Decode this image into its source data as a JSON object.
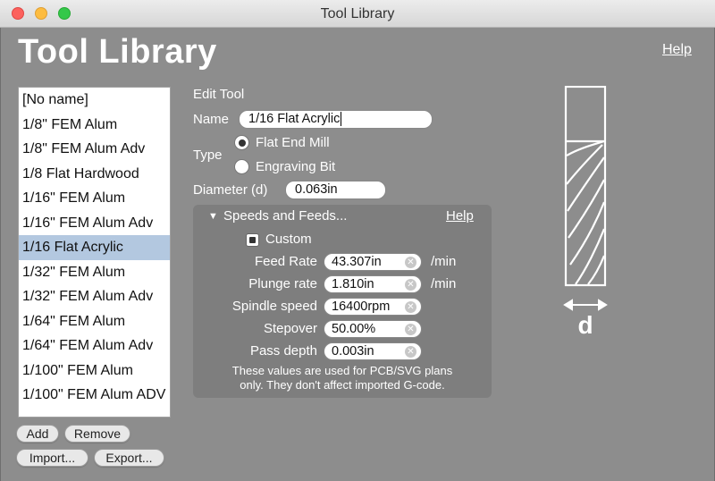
{
  "window": {
    "title": "Tool Library"
  },
  "header": {
    "title": "Tool Library",
    "help": "Help"
  },
  "tools": [
    "[No name]",
    "1/8\" FEM Alum",
    "1/8\" FEM Alum Adv",
    "1/8 Flat Hardwood",
    "1/16\" FEM Alum",
    "1/16\" FEM Alum Adv",
    "1/16 Flat Acrylic",
    "1/32\" FEM Alum",
    "1/32\" FEM Alum Adv",
    "1/64\" FEM Alum",
    "1/64\" FEM Alum Adv",
    "1/100\" FEM Alum",
    "1/100\" FEM Alum ADV"
  ],
  "selected_index": 6,
  "list_buttons": {
    "add": "Add",
    "remove": "Remove",
    "import": "Import...",
    "export": "Export..."
  },
  "edit": {
    "heading": "Edit Tool",
    "name_label": "Name",
    "name_value": "1/16 Flat Acrylic",
    "type_label": "Type",
    "type_flat": "Flat End Mill",
    "type_engraving": "Engraving Bit",
    "diameter_label": "Diameter (d)",
    "diameter_value": "0.063in"
  },
  "speeds": {
    "heading": "Speeds and Feeds...",
    "help": "Help",
    "custom_label": "Custom",
    "feed_label": "Feed Rate",
    "feed_value": "43.307in",
    "feed_unit": "/min",
    "plunge_label": "Plunge rate",
    "plunge_value": "1.810in",
    "plunge_unit": "/min",
    "spindle_label": "Spindle speed",
    "spindle_value": "16400rpm",
    "stepover_label": "Stepover",
    "stepover_value": "50.00%",
    "pass_label": "Pass depth",
    "pass_value": "0.003in",
    "note_line1": "These values are used for PCB/SVG plans",
    "note_line2": "only. They don't affect imported G-code."
  },
  "diagram": {
    "label": "d"
  },
  "colors": {
    "selection": "#b3c8e0",
    "window_bg": "#8d8d8d"
  }
}
